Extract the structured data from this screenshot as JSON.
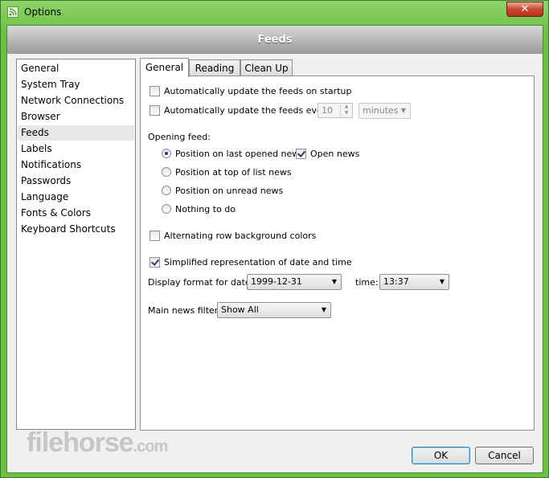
{
  "window": {
    "title": "Options",
    "close_glyph": "✕"
  },
  "header": {
    "title": "Feeds"
  },
  "sidebar": {
    "items": [
      {
        "label": "General"
      },
      {
        "label": "System Tray"
      },
      {
        "label": "Network Connections"
      },
      {
        "label": "Browser"
      },
      {
        "label": "Feeds",
        "selected": true
      },
      {
        "label": "Labels"
      },
      {
        "label": "Notifications"
      },
      {
        "label": "Passwords"
      },
      {
        "label": "Language"
      },
      {
        "label": "Fonts & Colors"
      },
      {
        "label": "Keyboard Shortcuts"
      }
    ]
  },
  "tabs": [
    {
      "label": "General",
      "active": true
    },
    {
      "label": "Reading"
    },
    {
      "label": "Clean Up"
    }
  ],
  "general": {
    "update_on_startup": {
      "label": "Automatically update the feeds on startup",
      "checked": false
    },
    "update_every": {
      "label": "Automatically update the feeds every",
      "checked": false,
      "value": "10",
      "unit": "minutes"
    },
    "opening_feed_label": "Opening feed:",
    "radio_options": [
      {
        "label": "Position on last opened news",
        "checked": true
      },
      {
        "label": "Position at top of list news",
        "checked": false
      },
      {
        "label": "Position on unread news",
        "checked": false
      },
      {
        "label": "Nothing to do",
        "checked": false
      }
    ],
    "open_news": {
      "label": "Open news",
      "checked": true
    },
    "alternating_rows": {
      "label": "Alternating row background colors",
      "checked": false
    },
    "simplified_date": {
      "label": "Simplified representation of date and time",
      "checked": true
    },
    "date_format_label": "Display format for date:",
    "date_format_value": "1999-12-31",
    "time_label": "time:",
    "time_format_value": "13:37",
    "news_filter_label": "Main news filter:",
    "news_filter_value": "Show All"
  },
  "footer": {
    "ok_label": "OK",
    "cancel_label": "Cancel",
    "watermark": "filehorse",
    "watermark_suffix": ".com"
  },
  "colors": {
    "frame": "#6cc046",
    "header_bar": "#9a9a9a",
    "selection": "#e8e8e8"
  }
}
